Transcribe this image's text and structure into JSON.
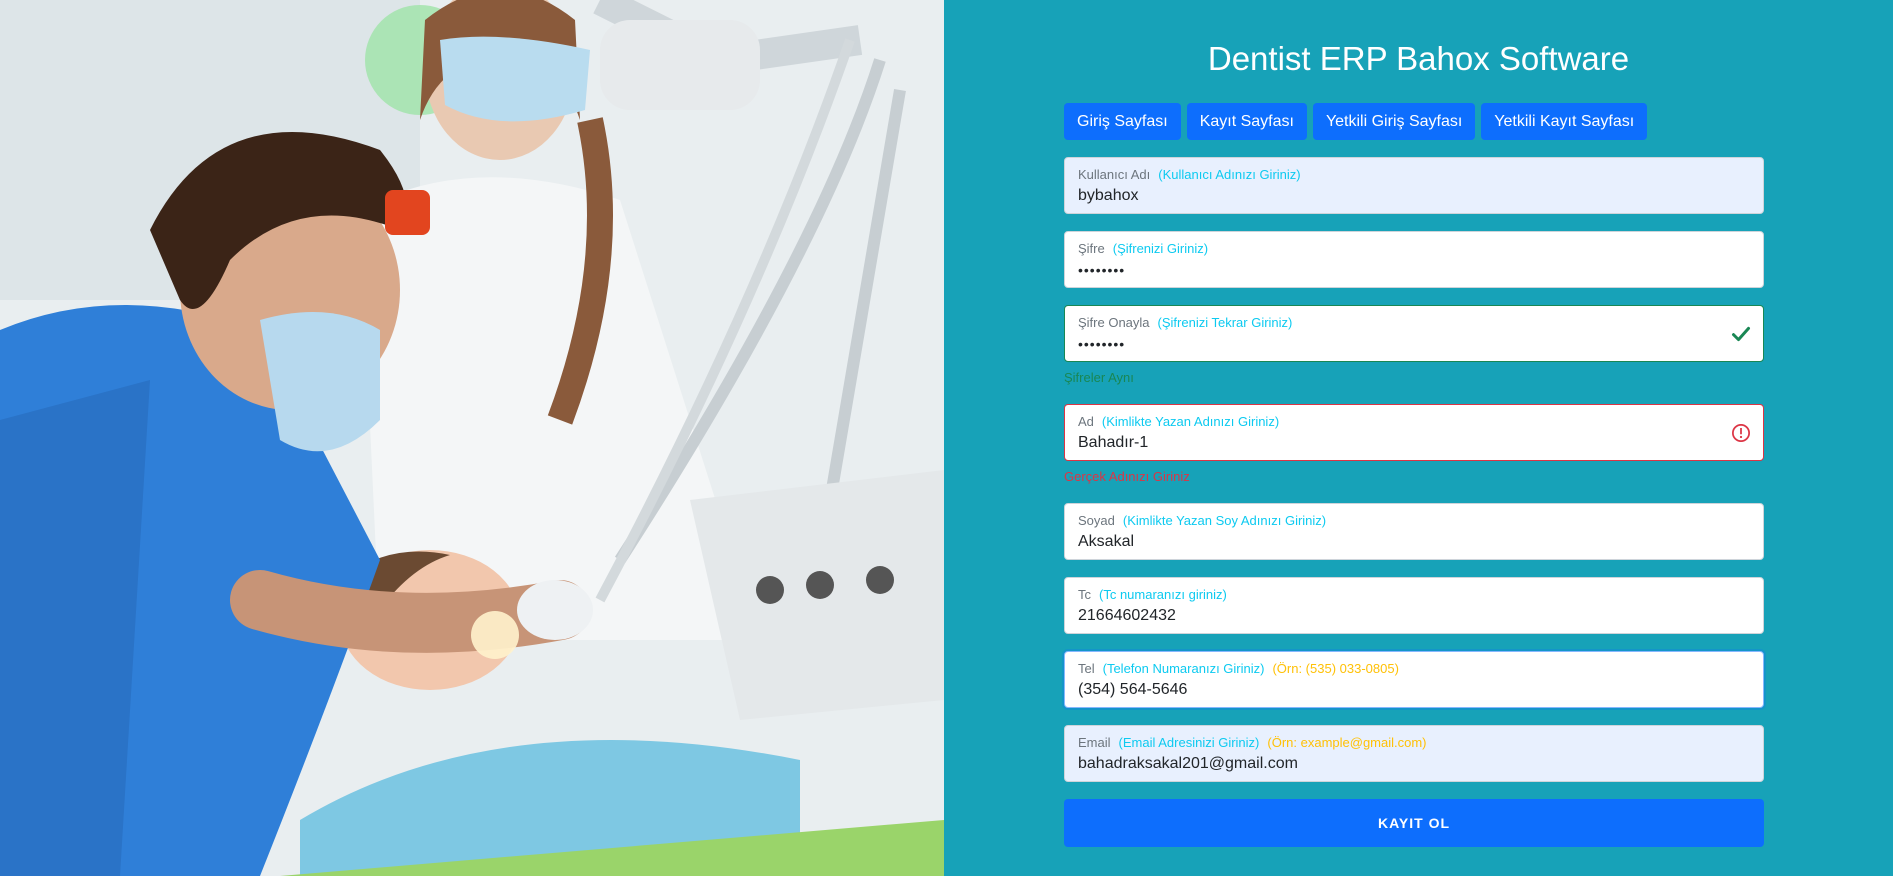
{
  "title": "Dentist ERP Bahox Software",
  "nav": [
    {
      "label": "Giriş Sayfası"
    },
    {
      "label": "Kayıt Sayfası"
    },
    {
      "label": "Yetkili Giriş Sayfası"
    },
    {
      "label": "Yetkili Kayıt Sayfası"
    }
  ],
  "form": {
    "username": {
      "label": "Kullanıcı Adı",
      "hint": "(Kullanıcı Adınızı Giriniz)",
      "value": "bybahox"
    },
    "password": {
      "label": "Şifre",
      "hint": "(Şifrenizi Giriniz)",
      "value": "••••••••"
    },
    "password_confirm": {
      "label": "Şifre Onayla",
      "hint": "(Şifrenizi Tekrar Giriniz)",
      "value": "••••••••",
      "feedback": "Şifreler Aynı",
      "icon": "check-icon"
    },
    "first_name": {
      "label": "Ad",
      "hint": "(Kimlikte Yazan Adınızı Giriniz)",
      "value": "Bahadır-1",
      "feedback": "Gerçek Adınızı Giriniz",
      "icon": "error-icon"
    },
    "last_name": {
      "label": "Soyad",
      "hint": "(Kimlikte Yazan Soy Adınızı Giriniz)",
      "value": "Aksakal"
    },
    "tc": {
      "label": "Tc",
      "hint": "(Tc numaranızı giriniz)",
      "value": "21664602432"
    },
    "phone": {
      "label": "Tel",
      "hint": "(Telefon Numaranızı Giriniz)",
      "example": "(Örn: (535) 033-0805)",
      "value": "(354) 564-5646"
    },
    "email": {
      "label": "Email",
      "hint": "(Email Adresinizi Giriniz)",
      "example": "(Örn: example@gmail.com)",
      "value": "bahadraksakal201@gmail.com"
    }
  },
  "submit_label": "KAYIT OL",
  "colors": {
    "panel": "#17a2b8",
    "primary": "#0d6efd",
    "valid": "#198754",
    "invalid": "#dc3545",
    "hint": "#0dcaf0",
    "example": "#ffc107"
  }
}
